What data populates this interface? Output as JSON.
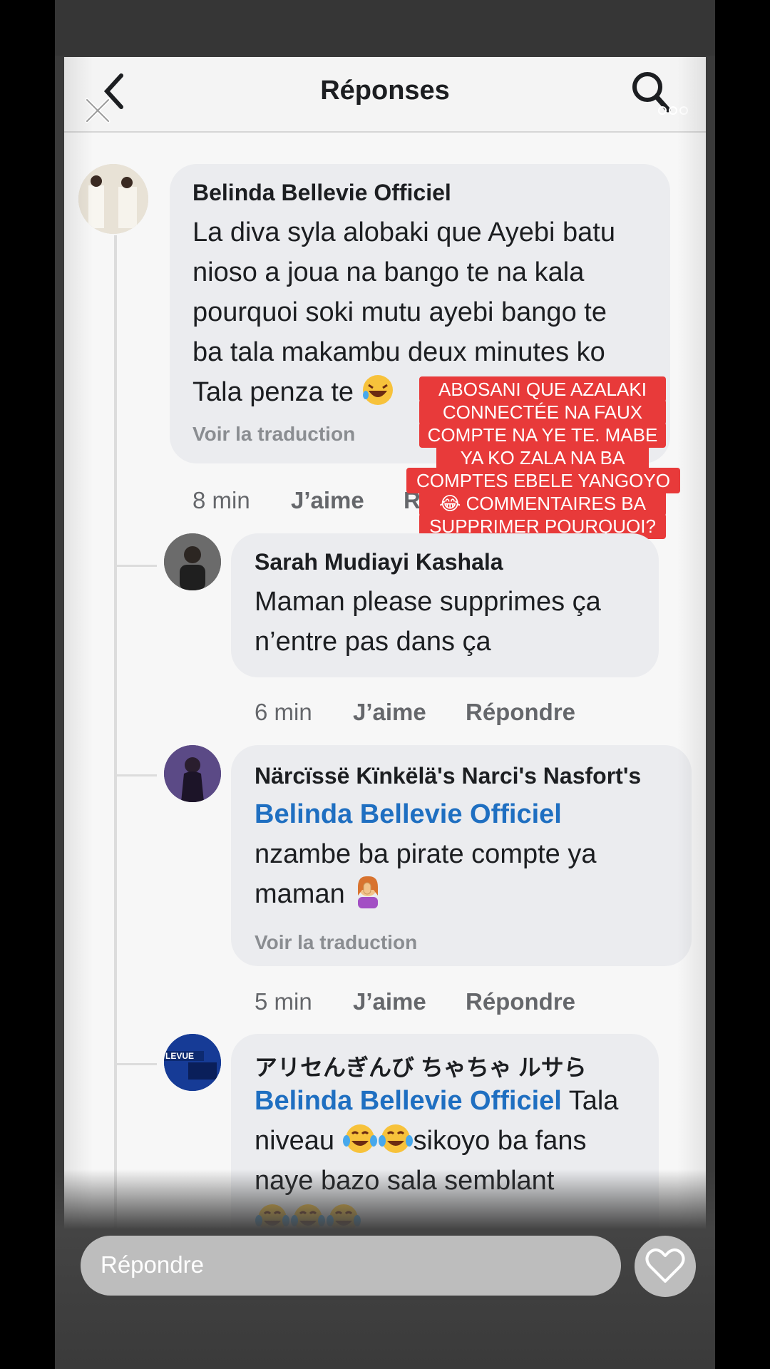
{
  "header": {
    "title": "Réponses"
  },
  "comments": [
    {
      "author": "Belinda Bellevie Officiel",
      "text_lines": [
        "La diva syla alobaki que Ayebi batu",
        "nioso a joua na bango te na kala",
        "pourquoi soki mutu ayebi bango te",
        "ba tala makambu deux minutes ko",
        "Tala penza te"
      ],
      "translate": "Voir la traduction",
      "time": "8 min",
      "like": "J’aime",
      "reply_partial": "R"
    },
    {
      "author": "Sarah Mudiayi Kashala",
      "text_lines": [
        "Maman please supprimes ça",
        "n’entre pas dans ça"
      ],
      "time": "6 min",
      "like": "J’aime",
      "reply": "Répondre"
    },
    {
      "author": "Närcïssë Kïnkëlä's Narci's Nasfort's",
      "mention": "Belinda Bellevie Officiel",
      "text_lines": [
        "nzambe ba pirate compte ya",
        "maman"
      ],
      "translate": "Voir la traduction",
      "time": "5 min",
      "like": "J’aime",
      "reply": "Répondre"
    },
    {
      "author": "アリセんぎんび ちゃちゃ ルサら",
      "mention": "Belinda Bellevie Officiel",
      "text_after_mention": " Tala",
      "text_lines": [
        "niveau",
        "sikoyo ba fans",
        "naye bazo sala semblant"
      ]
    }
  ],
  "overlay": {
    "lines": [
      "ABOSANI QUE AZALAKI",
      "CONNECTÉE NA FAUX",
      "COMPTE NA YE TE. MABE",
      "YA KO ZALA NA BA",
      "COMPTES EBELE YANGOYO",
      "😂 COMMENTAIRES BA",
      "SUPPRIMER POURQUOI?"
    ]
  },
  "reply_bar": {
    "placeholder": "Répondre"
  },
  "icons": [
    "back-arrow-icon",
    "close-icon",
    "search-icon",
    "more-icon",
    "heart-icon",
    "laughing-emoji-icon",
    "woman-facepalming-emoji-icon",
    "tears-of-joy-emoji-icon"
  ],
  "colors": {
    "mention": "#1f6fc1",
    "overlay": "#e83a3a",
    "bubble": "#ebecef"
  }
}
